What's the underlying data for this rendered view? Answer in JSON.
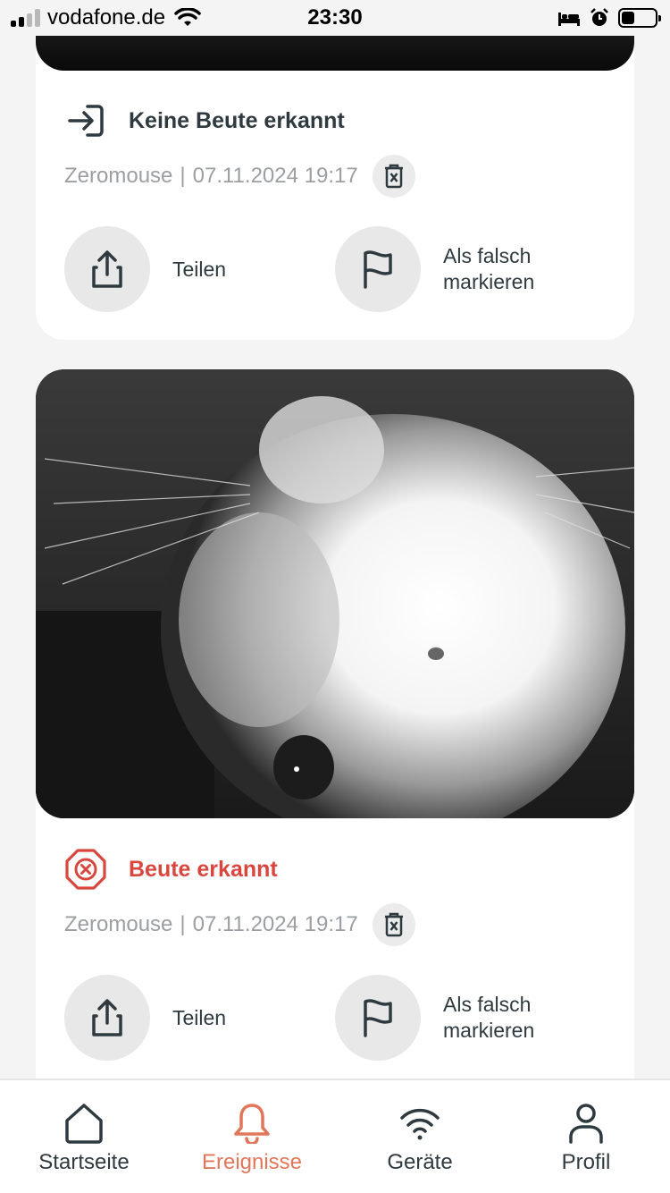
{
  "status_bar": {
    "carrier": "vodafone.de",
    "time": "23:30",
    "battery_level": 0.3
  },
  "events": [
    {
      "status": "Keine Beute erkannt",
      "status_icon": "enter-icon",
      "device": "Zeromouse",
      "separator": "|",
      "timestamp": "07.11.2024 19:17",
      "share_label": "Teilen",
      "report_label_line1": "Als falsch",
      "report_label_line2": "markieren"
    },
    {
      "status": "Beute erkannt",
      "status_icon": "prey-detected-icon",
      "status_color": "#d9463e",
      "device": "Zeromouse",
      "separator": "|",
      "timestamp": "07.11.2024 19:17",
      "share_label": "Teilen",
      "report_label_line1": "Als falsch",
      "report_label_line2": "markieren"
    }
  ],
  "tabbar": {
    "items": [
      {
        "label": "Startseite",
        "icon": "home-icon"
      },
      {
        "label": "Ereignisse",
        "icon": "bell-icon",
        "active": true
      },
      {
        "label": "Geräte",
        "icon": "wifi-icon"
      },
      {
        "label": "Profil",
        "icon": "user-icon"
      }
    ],
    "active_color": "#e0775b"
  }
}
